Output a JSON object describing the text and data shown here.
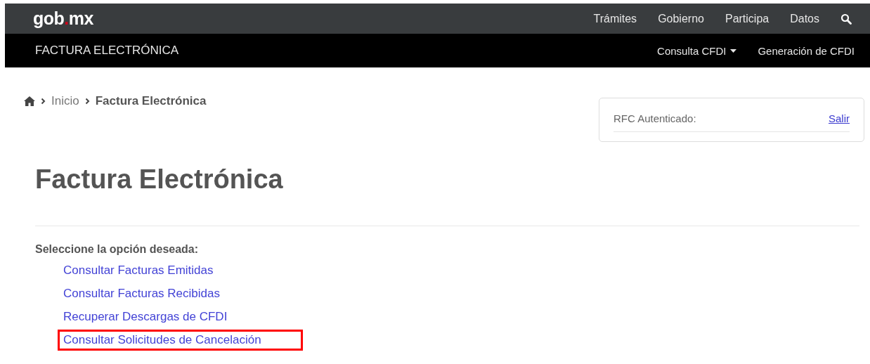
{
  "top_bar": {
    "logo_main": "gob",
    "logo_dot": ".",
    "logo_end": "mx",
    "nav": [
      "Trámites",
      "Gobierno",
      "Participa",
      "Datos"
    ]
  },
  "sub_bar": {
    "title": "FACTURA ELECTRÓNICA",
    "menu": [
      {
        "label": "Consulta CFDI",
        "dropdown": true
      },
      {
        "label": "Generación de CFDI",
        "dropdown": false
      }
    ]
  },
  "breadcrumb": [
    {
      "label": "Inicio",
      "current": false
    },
    {
      "label": "Factura Electrónica",
      "current": true
    }
  ],
  "auth_card": {
    "label": "RFC Autenticado:",
    "link": "Salir"
  },
  "heading": "Factura Electrónica",
  "prompt": "Seleccione la opción deseada:",
  "options": [
    {
      "label": "Consultar Facturas Emitidas",
      "highlighted": false
    },
    {
      "label": "Consultar Facturas Recibidas",
      "highlighted": false
    },
    {
      "label": "Recuperar Descargas de CFDI",
      "highlighted": false
    },
    {
      "label": "Consultar Solicitudes de Cancelación",
      "highlighted": true
    }
  ]
}
